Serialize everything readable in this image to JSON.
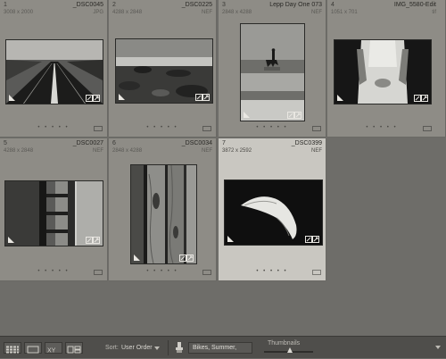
{
  "cells": [
    {
      "index": "1",
      "name": "_DSC0045",
      "dims": "3008 x 2000",
      "ext": "JPG",
      "selected": false
    },
    {
      "index": "2",
      "name": "_DSC0225",
      "dims": "4288 x 2848",
      "ext": "NEF",
      "selected": false
    },
    {
      "index": "3",
      "name": "Lepp Day One 073",
      "dims": "2848 x 4288",
      "ext": "NEF",
      "selected": false
    },
    {
      "index": "4",
      "name": "IMG_5580-Edit",
      "dims": "1051 x 701",
      "ext": "tif",
      "selected": false
    },
    {
      "index": "5",
      "name": "_DSC0027",
      "dims": "4288 x 2848",
      "ext": "NEF",
      "selected": false
    },
    {
      "index": "6",
      "name": "_DSC0034",
      "dims": "2848 x 4288",
      "ext": "NEF",
      "selected": false
    },
    {
      "index": "7",
      "name": "_DSC0399",
      "dims": "3872 x 2592",
      "ext": "NEF",
      "selected": true
    }
  ],
  "rating_dots": "• • • • •",
  "toolbar": {
    "sort_label": "Sort:",
    "sort_value": "User Order",
    "keyword_value": "Bikes, Summer,",
    "thumbnails_label": "Thumbnails"
  },
  "icons": {
    "grid": "grid-view-icon",
    "loupe": "loupe-view-icon",
    "compare": "compare-view-icon",
    "survey": "survey-view-icon",
    "painter": "painter-icon",
    "dropdown": "chevron-down-icon"
  }
}
